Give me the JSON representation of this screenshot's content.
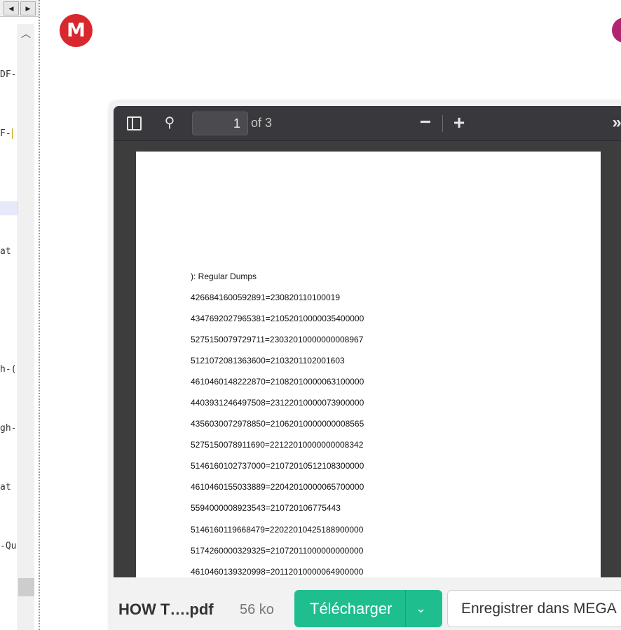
{
  "editor": {
    "nav_left": "◀",
    "nav_right": "▶",
    "scroll_up": "︿",
    "lines": [
      "DF-",
      "F-",
      "at",
      "h-(",
      "gh-",
      "at",
      "-Qu"
    ]
  },
  "mega": {
    "logo_letter": "M"
  },
  "pdf_viewer": {
    "page_number": "1",
    "page_count": "of 3",
    "zoom_out": "−",
    "zoom_in": "+",
    "more": "»",
    "search_icon": "⚲",
    "heading": "): Regular Dumps",
    "entries": [
      "4266841600592891=230820110100019",
      "4347692027965381=21052010000035400000",
      "5275150079729711=23032010000000008967",
      "5121072081363600=2103201102001603",
      "4610460148222870=21082010000063100000",
      "4403931246497508=23122010000073900000",
      "4356030072978850=21062010000000008565",
      "5275150078911690=22122010000000008342",
      "5146160102737000=21072010512108300000",
      "4610460155033889=22042010000065700000",
      "5594000008923543=210720106775443",
      "5146160119668479=22022010425188900000",
      "5174260000329325=21072011000000000000",
      "4610460139320998=20112010000064900000"
    ]
  },
  "bottom_bar": {
    "file_name": "HOW T….pdf",
    "file_size": "56 ko",
    "download_label": "Télécharger",
    "chevron": "⌄",
    "save_label": "Enregistrer dans MEGA"
  },
  "colors": {
    "mega_red": "#d9272e",
    "download_green": "#1fbe8f",
    "toolbar": "#38383d",
    "avatar": "#b0256f"
  }
}
